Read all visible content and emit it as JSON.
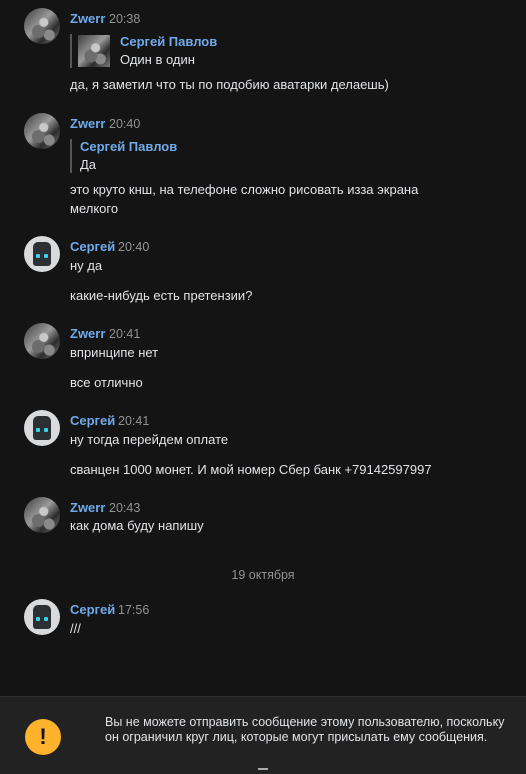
{
  "messages": [
    {
      "author": "Zwerr",
      "time": "20:38",
      "avatar": "zwerr-avatar",
      "quote": {
        "author": "Сергей Павлов",
        "text": "Один в один",
        "has_thumb": true
      },
      "lines": [
        "да, я заметил что ты по подобию аватарки делаешь)"
      ]
    },
    {
      "author": "Zwerr",
      "time": "20:40",
      "avatar": "zwerr-avatar",
      "quote": {
        "author": "Сергей Павлов",
        "text": "Да",
        "has_thumb": false
      },
      "lines": [
        "это круто кнш, на телефоне сложно рисовать изза экрана",
        "мелкого"
      ]
    },
    {
      "author": "Сергей",
      "time": "20:40",
      "avatar": "robot-avatar",
      "lines": [
        "ну да",
        "какие-нибудь есть претензии?"
      ]
    },
    {
      "author": "Zwerr",
      "time": "20:41",
      "avatar": "zwerr-avatar",
      "lines": [
        "впринципе нет",
        "все отлично"
      ]
    },
    {
      "author": "Сергей",
      "time": "20:41",
      "avatar": "robot-avatar",
      "lines": [
        "ну тогда перейдем оплате",
        "сванцен 1000 монет. И мой номер Сбер банк +79142597997"
      ]
    },
    {
      "author": "Zwerr",
      "time": "20:43",
      "avatar": "zwerr-avatar",
      "lines": [
        "как дома буду напишу"
      ]
    },
    {
      "author": "Сергей",
      "time": "17:56",
      "avatar": "robot-avatar",
      "lines": [
        "///"
      ]
    }
  ],
  "date_separator": "19 октября",
  "blocked_notice": {
    "icon": "exclamation-icon",
    "color": "#ffb22b",
    "text": "Вы не можете отправить сообщение этому пользователю, поскольку он ограничил круг лиц, которые могут присылать ему сообщения."
  }
}
